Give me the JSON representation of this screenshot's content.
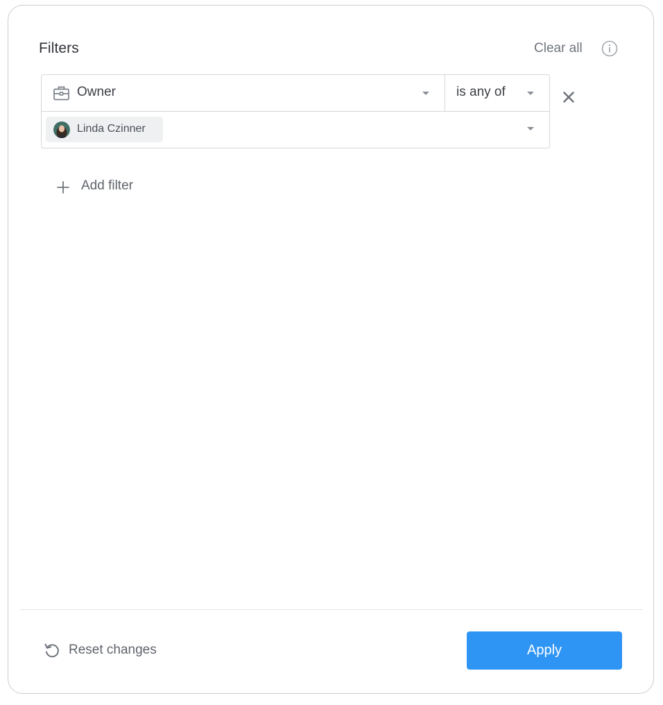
{
  "header": {
    "title": "Filters",
    "clear_all_label": "Clear all",
    "info_icon": "info-icon"
  },
  "filters": [
    {
      "field_icon": "briefcase-icon",
      "field_label": "Owner",
      "operator_label": "is any of",
      "values": [
        {
          "label": "Linda Czinner",
          "avatar": "avatar"
        }
      ],
      "remove_icon": "close-icon"
    }
  ],
  "add_filter": {
    "label": "Add filter",
    "icon": "plus-icon"
  },
  "footer": {
    "reset_label": "Reset changes",
    "reset_icon": "undo-icon",
    "apply_label": "Apply"
  },
  "colors": {
    "primary": "#2f95f5",
    "border": "#d3d6da",
    "chip_bg": "#eef0f2",
    "text_dark": "#2f3237",
    "text_muted": "#6f747c"
  }
}
